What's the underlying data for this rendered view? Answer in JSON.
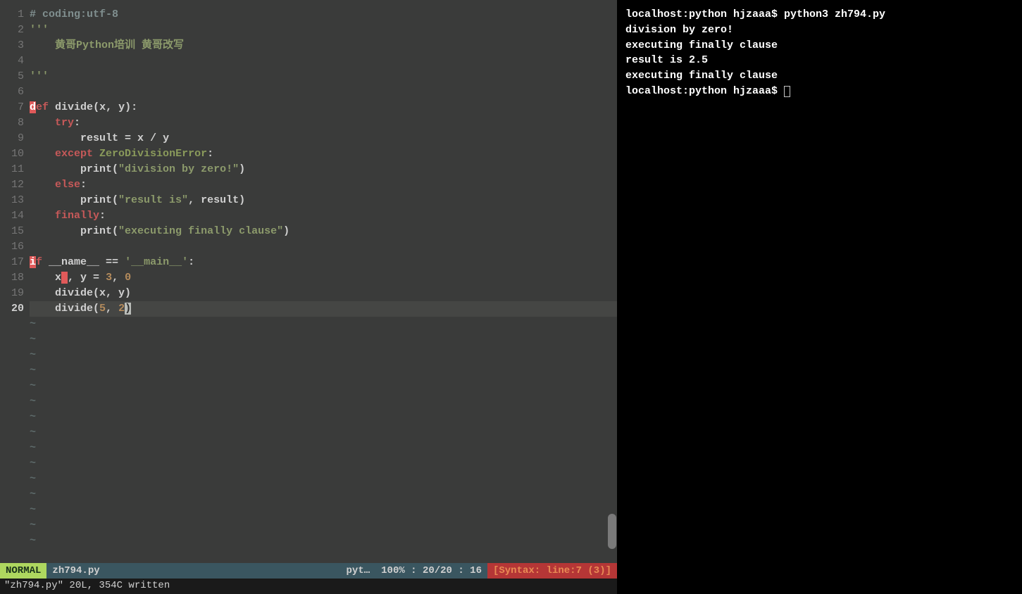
{
  "editor": {
    "gutter_lines": [
      "1",
      "2",
      "3",
      "4",
      "5",
      "6",
      "7",
      "8",
      "9",
      "10",
      "11",
      "12",
      "13",
      "14",
      "15",
      "16",
      "17",
      "18",
      "19",
      "20"
    ],
    "current_line_index": 19,
    "code_lines": [
      {
        "tokens": [
          {
            "t": "# coding:utf-8",
            "c": "c-comment"
          }
        ]
      },
      {
        "tokens": [
          {
            "t": "'''",
            "c": "c-string"
          }
        ]
      },
      {
        "tokens": [
          {
            "t": "    黄哥Python培训 黄哥改写",
            "c": "c-string"
          }
        ]
      },
      {
        "tokens": []
      },
      {
        "tokens": [
          {
            "t": "'''",
            "c": "c-string"
          }
        ]
      },
      {
        "tokens": []
      },
      {
        "tokens": [
          {
            "t": "d",
            "c": "hl-red"
          },
          {
            "t": "ef",
            "c": "c-keyword"
          },
          {
            "t": " ",
            "c": ""
          },
          {
            "t": "divide",
            "c": "c-func"
          },
          {
            "t": "(x, y):",
            "c": "c-punct"
          }
        ]
      },
      {
        "tokens": [
          {
            "t": "    ",
            "c": ""
          },
          {
            "t": "try",
            "c": "c-keyword"
          },
          {
            "t": ":",
            "c": "c-punct"
          }
        ]
      },
      {
        "tokens": [
          {
            "t": "        result ",
            "c": "c-ident"
          },
          {
            "t": "=",
            "c": "c-punct"
          },
          {
            "t": " x ",
            "c": "c-ident"
          },
          {
            "t": "/",
            "c": "c-punct"
          },
          {
            "t": " y",
            "c": "c-ident"
          }
        ]
      },
      {
        "tokens": [
          {
            "t": "    ",
            "c": ""
          },
          {
            "t": "except",
            "c": "c-keyword"
          },
          {
            "t": " ",
            "c": ""
          },
          {
            "t": "ZeroDivisionError",
            "c": "c-builtin"
          },
          {
            "t": ":",
            "c": "c-punct"
          }
        ]
      },
      {
        "tokens": [
          {
            "t": "        ",
            "c": ""
          },
          {
            "t": "print",
            "c": "c-func"
          },
          {
            "t": "(",
            "c": "c-punct"
          },
          {
            "t": "\"division by zero!\"",
            "c": "c-string"
          },
          {
            "t": ")",
            "c": "c-punct"
          }
        ]
      },
      {
        "tokens": [
          {
            "t": "    ",
            "c": ""
          },
          {
            "t": "else",
            "c": "c-keyword"
          },
          {
            "t": ":",
            "c": "c-punct"
          }
        ]
      },
      {
        "tokens": [
          {
            "t": "        ",
            "c": ""
          },
          {
            "t": "print",
            "c": "c-func"
          },
          {
            "t": "(",
            "c": "c-punct"
          },
          {
            "t": "\"result is\"",
            "c": "c-string"
          },
          {
            "t": ", result)",
            "c": "c-punct"
          }
        ]
      },
      {
        "tokens": [
          {
            "t": "    ",
            "c": ""
          },
          {
            "t": "finally",
            "c": "c-keyword"
          },
          {
            "t": ":",
            "c": "c-punct"
          }
        ]
      },
      {
        "tokens": [
          {
            "t": "        ",
            "c": ""
          },
          {
            "t": "print",
            "c": "c-func"
          },
          {
            "t": "(",
            "c": "c-punct"
          },
          {
            "t": "\"executing finally clause\"",
            "c": "c-string"
          },
          {
            "t": ")",
            "c": "c-punct"
          }
        ]
      },
      {
        "tokens": []
      },
      {
        "tokens": [
          {
            "t": "i",
            "c": "hl-red"
          },
          {
            "t": "f",
            "c": "c-keyword"
          },
          {
            "t": " __name__ ",
            "c": "c-ident"
          },
          {
            "t": "==",
            "c": "c-punct"
          },
          {
            "t": " ",
            "c": ""
          },
          {
            "t": "'__main__'",
            "c": "c-string"
          },
          {
            "t": ":",
            "c": "c-punct"
          }
        ]
      },
      {
        "tokens": [
          {
            "t": "    x",
            "c": "c-ident"
          },
          {
            "t": " ",
            "c": "hl-red"
          },
          {
            "t": ", y ",
            "c": "c-ident"
          },
          {
            "t": "=",
            "c": "c-punct"
          },
          {
            "t": " ",
            "c": ""
          },
          {
            "t": "3",
            "c": "c-number"
          },
          {
            "t": ", ",
            "c": "c-punct"
          },
          {
            "t": "0",
            "c": "c-number"
          }
        ]
      },
      {
        "tokens": [
          {
            "t": "    divide(x, y)",
            "c": "c-ident"
          }
        ]
      },
      {
        "tokens": [
          {
            "t": "    divide(",
            "c": "c-ident"
          },
          {
            "t": "5",
            "c": "c-number"
          },
          {
            "t": ", ",
            "c": "c-punct"
          },
          {
            "t": "2",
            "c": "c-number"
          },
          {
            "t": ")",
            "c": "hl-cursor"
          }
        ],
        "current": true
      }
    ],
    "tilde_count": 15
  },
  "statusline": {
    "mode": " NORMAL ",
    "sep_r": "",
    "filename": "  zh794.py",
    "filetype": "pyt… ",
    "sep_l": "",
    "position": " 100% :  20/20 : 16 ",
    "error": " [Syntax: line:7 (3)] "
  },
  "cmdline": "\"zh794.py\" 20L, 354C written",
  "terminal": {
    "lines": [
      "localhost:python hjzaaa$ python3 zh794.py",
      "division by zero!",
      "executing finally clause",
      "result is 2.5",
      "executing finally clause"
    ],
    "prompt": "localhost:python hjzaaa$ "
  }
}
